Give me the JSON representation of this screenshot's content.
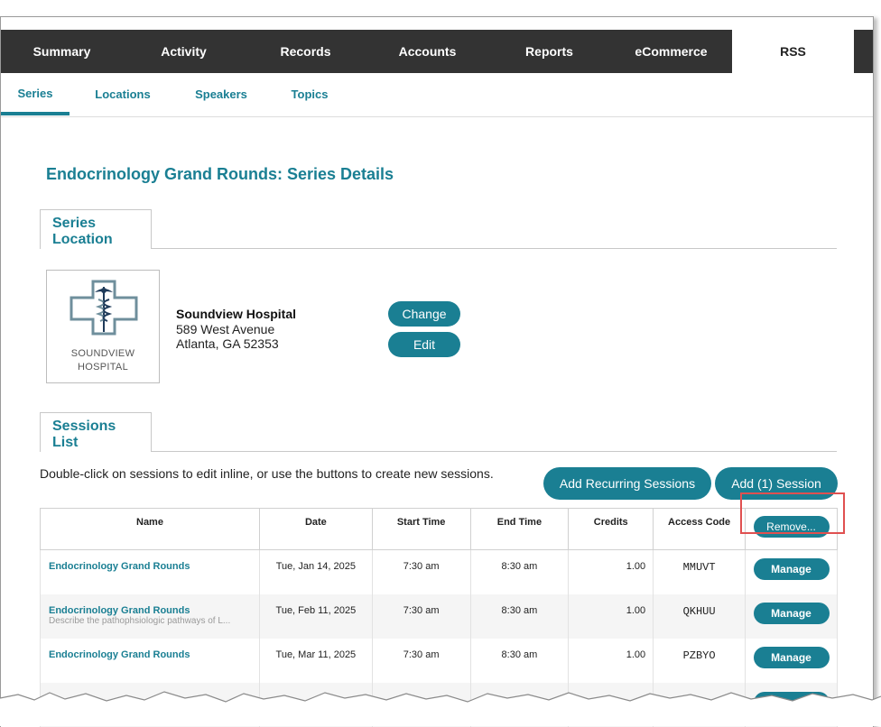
{
  "top_tabs": [
    {
      "label": "Summary"
    },
    {
      "label": "Activity"
    },
    {
      "label": "Records"
    },
    {
      "label": "Accounts"
    },
    {
      "label": "Reports"
    },
    {
      "label": "eCommerce"
    },
    {
      "label": "RSS"
    }
  ],
  "sub_tabs": [
    {
      "label": "Series"
    },
    {
      "label": "Locations"
    },
    {
      "label": "Speakers"
    },
    {
      "label": "Topics"
    }
  ],
  "page_title": "Endocrinology Grand Rounds: Series Details",
  "location_section": {
    "tab_line1": "Series",
    "tab_line2": "Location",
    "logo_text_line1": "SOUNDVIEW",
    "logo_text_line2": "HOSPITAL",
    "name": "Soundview Hospital",
    "address1": "589 West Avenue",
    "address2": "Atlanta, GA 52353",
    "change_label": "Change",
    "edit_label": "Edit"
  },
  "sessions_section": {
    "tab_line1": "Sessions",
    "tab_line2": "List",
    "instructions": "Double-click on sessions to edit inline, or use the buttons to create new sessions.",
    "add_recurring_label": "Add Recurring Sessions",
    "add_session_label": "Add (1) Session",
    "remove_label": "Remove...",
    "columns": [
      "Name",
      "Date",
      "Start Time",
      "End Time",
      "Credits",
      "Access Code"
    ],
    "rows": [
      {
        "name": "Endocrinology Grand Rounds",
        "desc": "",
        "date": "Tue, Jan 14, 2025",
        "start": "7:30 am",
        "end": "8:30 am",
        "credits": "1.00",
        "code": "MMUVT",
        "action": "Manage"
      },
      {
        "name": "Endocrinology Grand Rounds",
        "desc": "Describe the pathophsiologic pathways of L...",
        "date": "Tue, Feb 11, 2025",
        "start": "7:30 am",
        "end": "8:30 am",
        "credits": "1.00",
        "code": "QKHUU",
        "action": "Manage"
      },
      {
        "name": "Endocrinology Grand Rounds",
        "desc": "",
        "date": "Tue, Mar 11, 2025",
        "start": "7:30 am",
        "end": "8:30 am",
        "credits": "1.00",
        "code": "PZBYO",
        "action": "Manage"
      }
    ]
  },
  "colors": {
    "accent": "#1a7f93",
    "nav_bg": "#333333",
    "highlight": "#e05050"
  }
}
